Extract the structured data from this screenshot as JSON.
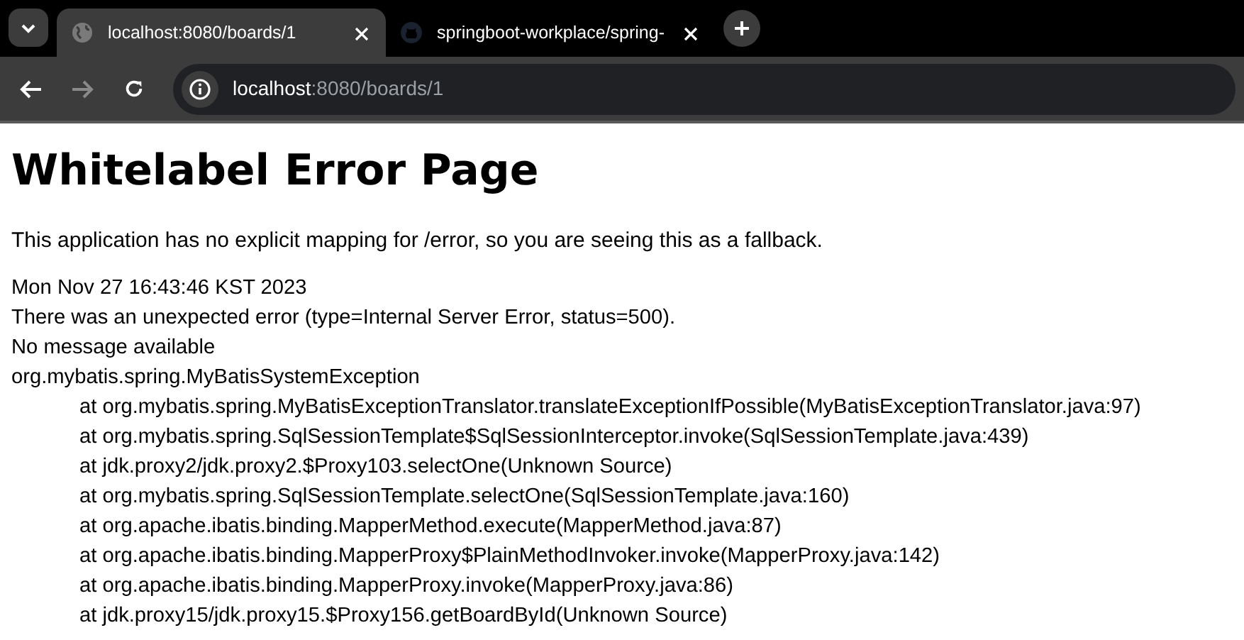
{
  "tabs": [
    {
      "title": "localhost:8080/boards/1",
      "selected": true
    },
    {
      "title": "springboot-workplace/spring-",
      "selected": false
    }
  ],
  "toolbar": {
    "back_enabled": true,
    "forward_enabled": false
  },
  "address": {
    "host": "localhost",
    "path": ":8080/boards/1"
  },
  "page": {
    "heading": "Whitelabel Error Page",
    "intro": "This application has no explicit mapping for /error, so you are seeing this as a fallback.",
    "lines": [
      {
        "kind": "plain",
        "text": "Mon Nov 27 16:43:46 KST 2023"
      },
      {
        "kind": "plain",
        "text": "There was an unexpected error (type=Internal Server Error, status=500)."
      },
      {
        "kind": "plain",
        "text": "No message available"
      },
      {
        "kind": "plain",
        "text": "org.mybatis.spring.MyBatisSystemException"
      },
      {
        "kind": "frame",
        "text": "at org.mybatis.spring.MyBatisExceptionTranslator.translateExceptionIfPossible(MyBatisExceptionTranslator.java:97)"
      },
      {
        "kind": "frame",
        "text": "at org.mybatis.spring.SqlSessionTemplate$SqlSessionInterceptor.invoke(SqlSessionTemplate.java:439)"
      },
      {
        "kind": "frame",
        "text": "at jdk.proxy2/jdk.proxy2.$Proxy103.selectOne(Unknown Source)"
      },
      {
        "kind": "frame",
        "text": "at org.mybatis.spring.SqlSessionTemplate.selectOne(SqlSessionTemplate.java:160)"
      },
      {
        "kind": "frame",
        "text": "at org.apache.ibatis.binding.MapperMethod.execute(MapperMethod.java:87)"
      },
      {
        "kind": "frame",
        "text": "at org.apache.ibatis.binding.MapperProxy$PlainMethodInvoker.invoke(MapperProxy.java:142)"
      },
      {
        "kind": "frame",
        "text": "at org.apache.ibatis.binding.MapperProxy.invoke(MapperProxy.java:86)"
      },
      {
        "kind": "frame",
        "text": "at jdk.proxy15/jdk.proxy15.$Proxy156.getBoardById(Unknown Source)"
      }
    ]
  }
}
